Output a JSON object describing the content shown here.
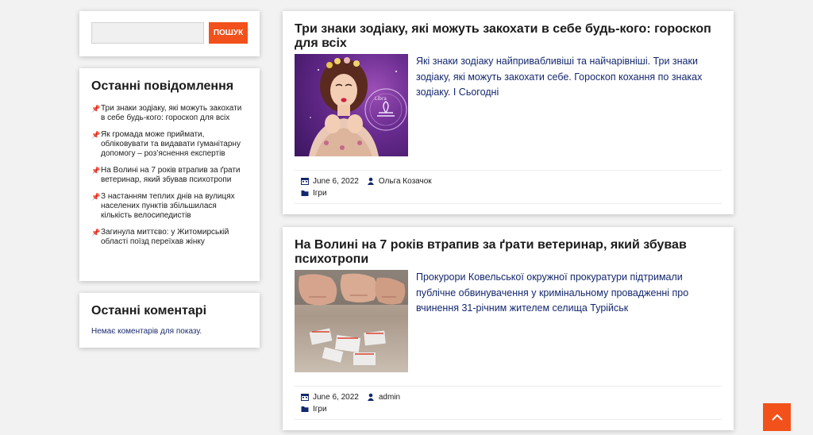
{
  "search": {
    "value": "",
    "placeholder": "",
    "button_label": "пошук"
  },
  "recent_posts": {
    "title": "Останні повідомлення",
    "items": [
      {
        "label": "Три знаки зодіаку, які можуть закохати в себе будь-кого: гороскоп для всіх"
      },
      {
        "label": "Як громада може приймати, обліковувати та видавати гуманітарну допомогу – роз’яснення експертів"
      },
      {
        "label": "На Волині на 7 років втрапив за ґрати ветеринар, який збував психотропи"
      },
      {
        "label": "З настанням теплих днів на вулицях населених пунктів збільшилася кількість велосипедистів"
      },
      {
        "label": "Загинула миттєво: у Житомирській області поїзд переїхав жінку"
      }
    ]
  },
  "recent_comments": {
    "title": "Останні коментарі",
    "empty_text": "Немає коментарів для показу."
  },
  "posts": [
    {
      "title": "Три знаки зодіаку, які можуть закохати в себе будь-кого: гороскоп для всіх",
      "excerpt": "Які знаки зодіаку найпривабливіші та найчарівніші. Три знаки зодіаку, які можуть закохати себе. Гороскоп кохання по знаках зодіаку. І Сьогодні",
      "date": "June 6, 2022",
      "author": "Ольга Козачок",
      "category": "Ігри",
      "thumb_label": "Libra"
    },
    {
      "title": "На Волині на 7 років втрапив за ґрати ветеринар, який збував психотропи",
      "excerpt": "Прокурори Ковельської окружної прокуратури підтримали публічне обвинувачення у кримінальному провадженні про вчинення 31-річним жителем селища Турійськ",
      "date": "June 6, 2022",
      "author": "admin",
      "category": "Ігри"
    }
  ],
  "icons": {
    "pin": "pushpin-icon",
    "calendar": "calendar-icon",
    "author": "user-icon",
    "category": "folder-icon",
    "scroll_top": "chevron-up-icon"
  },
  "colors": {
    "accent": "#f2511c",
    "link": "#14286e",
    "background": "#f2f2f2"
  }
}
